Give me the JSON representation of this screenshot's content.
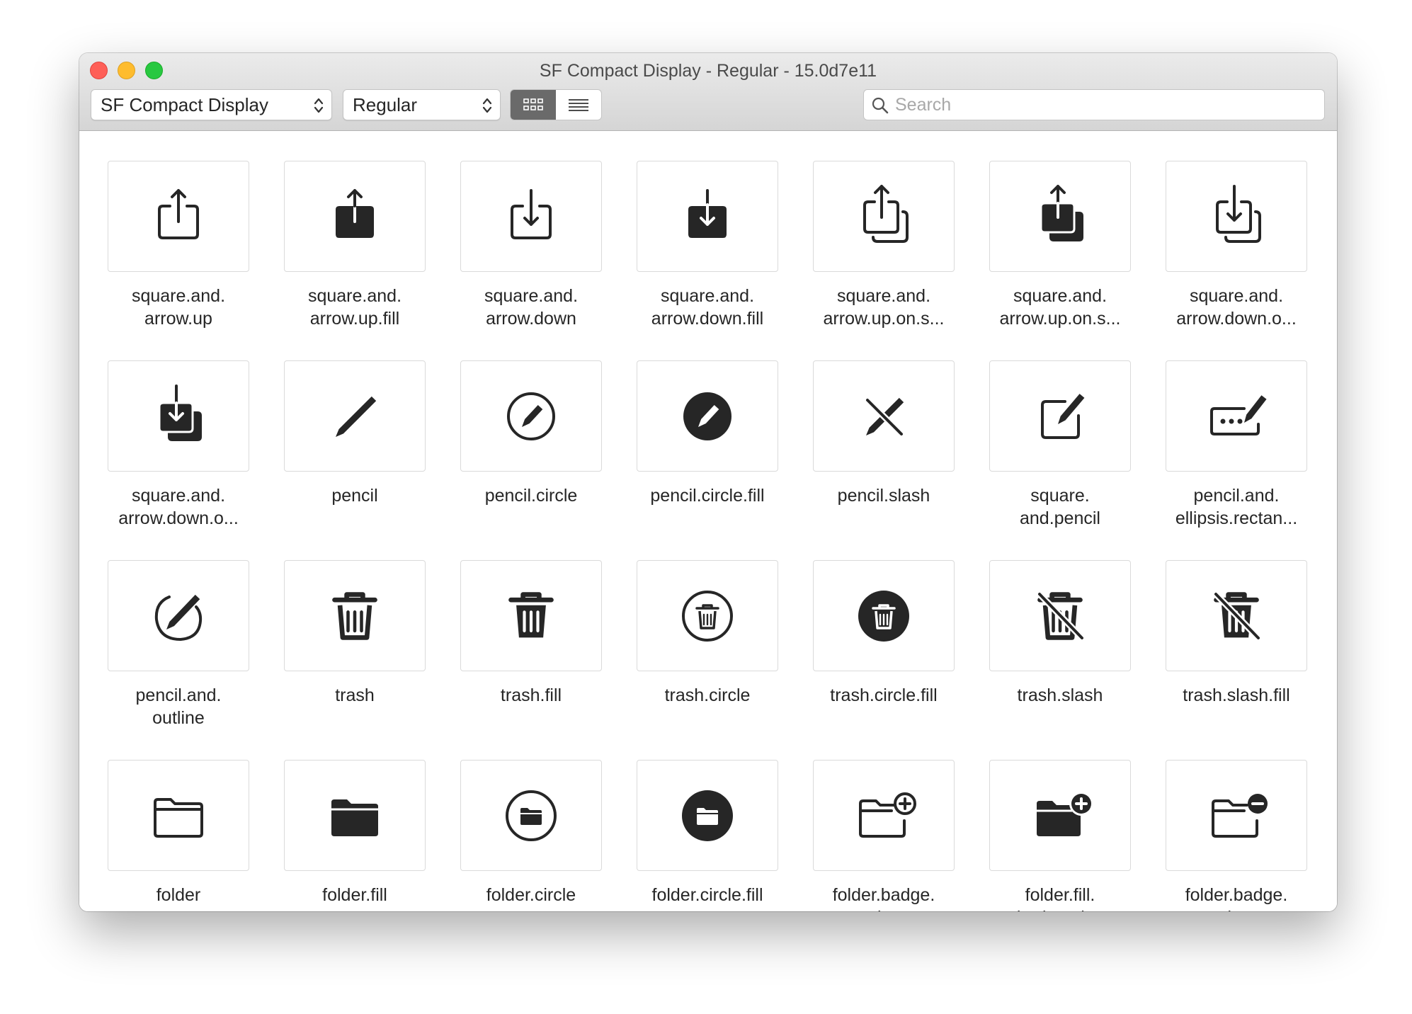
{
  "window": {
    "title": "SF Compact Display - Regular - 15.0d7e11"
  },
  "toolbar": {
    "font_select": "SF Compact Display",
    "weight_select": "Regular",
    "view_grid": "grid-view-icon",
    "view_list": "list-view-icon",
    "search_placeholder": "Search"
  },
  "symbols": [
    {
      "label": "square.and.\narrow.up",
      "icon": "square-and-arrow-up-icon"
    },
    {
      "label": "square.and.\narrow.up.fill",
      "icon": "square-and-arrow-up-fill-icon"
    },
    {
      "label": "square.and.\narrow.down",
      "icon": "square-and-arrow-down-icon"
    },
    {
      "label": "square.and.\narrow.down.fill",
      "icon": "square-and-arrow-down-fill-icon"
    },
    {
      "label": "square.and.\narrow.up.on.s...",
      "icon": "square-and-arrow-up-on-square-icon"
    },
    {
      "label": "square.and.\narrow.up.on.s...",
      "icon": "square-and-arrow-up-on-square-fill-icon"
    },
    {
      "label": "square.and.\narrow.down.o...",
      "icon": "square-and-arrow-down-on-square-icon"
    },
    {
      "label": "square.and.\narrow.down.o...",
      "icon": "square-and-arrow-down-on-square-fill-icon"
    },
    {
      "label": "pencil",
      "icon": "pencil-icon"
    },
    {
      "label": "pencil.circle",
      "icon": "pencil-circle-icon"
    },
    {
      "label": "pencil.circle.fill",
      "icon": "pencil-circle-fill-icon"
    },
    {
      "label": "pencil.slash",
      "icon": "pencil-slash-icon"
    },
    {
      "label": "square.\nand.pencil",
      "icon": "square-and-pencil-icon"
    },
    {
      "label": "pencil.and.\nellipsis.rectan...",
      "icon": "pencil-and-ellipsis-rectangle-icon"
    },
    {
      "label": "pencil.and.\noutline",
      "icon": "pencil-and-outline-icon"
    },
    {
      "label": "trash",
      "icon": "trash-icon"
    },
    {
      "label": "trash.fill",
      "icon": "trash-fill-icon"
    },
    {
      "label": "trash.circle",
      "icon": "trash-circle-icon"
    },
    {
      "label": "trash.circle.fill",
      "icon": "trash-circle-fill-icon"
    },
    {
      "label": "trash.slash",
      "icon": "trash-slash-icon"
    },
    {
      "label": "trash.slash.fill",
      "icon": "trash-slash-fill-icon"
    },
    {
      "label": "folder",
      "icon": "folder-icon"
    },
    {
      "label": "folder.fill",
      "icon": "folder-fill-icon"
    },
    {
      "label": "folder.circle",
      "icon": "folder-circle-icon"
    },
    {
      "label": "folder.circle.fill",
      "icon": "folder-circle-fill-icon"
    },
    {
      "label": "folder.badge.\nplus",
      "icon": "folder-badge-plus-icon"
    },
    {
      "label": "folder.fill.\nbadge.plus",
      "icon": "folder-fill-badge-plus-icon"
    },
    {
      "label": "folder.badge.\nminus",
      "icon": "folder-badge-minus-icon"
    }
  ]
}
